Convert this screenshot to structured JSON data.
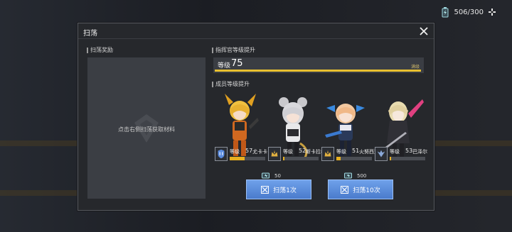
{
  "resource": {
    "value": "506/300"
  },
  "dialog": {
    "title": "扫荡",
    "reward_section": {
      "label": "扫荡奖励",
      "hint": "点击右侧扫荡获取材料"
    },
    "commander_section": {
      "label": "指挥官等级提升",
      "level_prefix": "等级",
      "level_value": "75",
      "max_tag": "满级",
      "progress": 1.0
    },
    "member_section": {
      "label": "成员等级提升"
    },
    "members": [
      {
        "level_prefix": "等级",
        "level": "57",
        "name": "尤卡卡",
        "progress": 0.42
      },
      {
        "level_prefix": "等级",
        "level": "52",
        "name": "斯卡拉格",
        "progress": 0.04
      },
      {
        "level_prefix": "等级",
        "level": "51",
        "name": "火努西亚",
        "progress": 0.12
      },
      {
        "level_prefix": "等级",
        "level": "53",
        "name": "巴泽尔",
        "progress": 0.04
      }
    ],
    "actions": [
      {
        "label": "扫荡1次",
        "cost": "50"
      },
      {
        "label": "扫荡10次",
        "cost": "500"
      }
    ]
  }
}
